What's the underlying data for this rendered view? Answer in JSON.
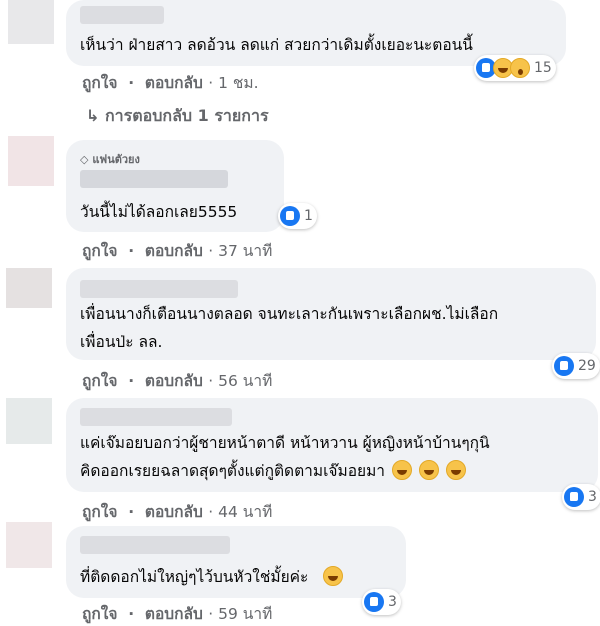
{
  "comments": [
    {
      "text_lines": [
        "เห็นว่า ฝ่ายสาว ลดอ้วน ลดแก่ สวยกว่าเดิมตั้งเยอะนะตอนนี้"
      ],
      "like_label": "ถูกใจ",
      "reply_label": "ตอบกลับ",
      "time": "· 1 ชม.",
      "reaction_count": "15",
      "reactions": [
        "like-icon",
        "haha-icon",
        "wow-icon"
      ]
    },
    {
      "badge": "แฟนตัวยง",
      "text_lines": [
        "วันนี้ไม่ได้ลอกเลย5555"
      ],
      "like_label": "ถูกใจ",
      "reply_label": "ตอบกลับ",
      "time": "· 37 นาที",
      "reaction_count": "1",
      "reactions": [
        "like-icon"
      ]
    },
    {
      "text_lines": [
        "เพื่อนนางก็เตือนนางตลอด จนทะเลาะกันเพราะเลือกผช.ไม่เลือก",
        "เพื่อนป่ะ ลล."
      ],
      "like_label": "ถูกใจ",
      "reply_label": "ตอบกลับ",
      "time": "· 56 นาที",
      "reaction_count": "29",
      "reactions": [
        "like-icon"
      ]
    },
    {
      "text_lines": [
        "แค่เจ๊มอยบอกว่าผู้ชายหน้าตาดี หน้าหวาน ผู้หญิงหน้าบ้านๆกุนิ",
        "คิดออกเรยยฉลาดสุดๆตั้งแต่กูติดตามเจ๊มอยมา"
      ],
      "like_label": "ถูกใจ",
      "reply_label": "ตอบกลับ",
      "time": "· 44 นาที",
      "reaction_count": "3",
      "reactions": [
        "like-icon"
      ]
    },
    {
      "text_lines": [
        "ที่ติดดอกไม่ใหญ่ๆไว้บนหัวใช่มั้ยค่ะ"
      ],
      "like_label": "ถูกใจ",
      "reply_label": "ตอบกลับ",
      "time": "· 59 นาที",
      "reaction_count": "3",
      "reactions": [
        "like-icon"
      ]
    }
  ],
  "replies_link": "↳ การตอบกลับ 1 รายการ"
}
